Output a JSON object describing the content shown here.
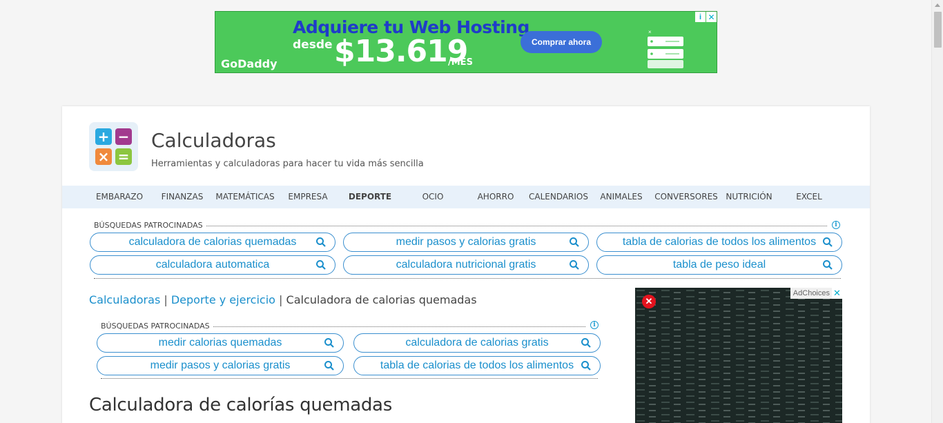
{
  "top_ad": {
    "headline": "Adquiere tu Web Hosting",
    "desde": "desde",
    "price": "$13.619",
    "per": "/MES",
    "brand": "GoDaddy",
    "cta": "Comprar ahora",
    "info_icon": "info-icon",
    "close_icon": "close-icon"
  },
  "site": {
    "title": "Calculadoras",
    "subtitle": "Herramientas y calculadoras para hacer tu vida más sencilla"
  },
  "nav": [
    {
      "label": "EMBARAZO"
    },
    {
      "label": "FINANZAS"
    },
    {
      "label": "MATEMÁTICAS"
    },
    {
      "label": "EMPRESA"
    },
    {
      "label": "DEPORTE"
    },
    {
      "label": "OCIO"
    },
    {
      "label": "AHORRO"
    },
    {
      "label": "CALENDARIOS"
    },
    {
      "label": "ANIMALES"
    },
    {
      "label": "CONVERSORES"
    },
    {
      "label": "NUTRICIÓN"
    },
    {
      "label": "EXCEL"
    }
  ],
  "sponsored_top": {
    "label": "BÚSQUEDAS PATROCINADAS",
    "items": [
      "calculadora de calorias quemadas",
      "medir pasos y calorias gratis",
      "tabla de calorias de todos los alimentos",
      "calculadora automatica",
      "calculadora nutricional gratis",
      "tabla de peso ideal"
    ]
  },
  "breadcrumb": {
    "home": "Calculadoras",
    "section": "Deporte y ejercicio",
    "current": "Calculadora de calorias quemadas",
    "sep": "|"
  },
  "sponsored_inner": {
    "label": "BÚSQUEDAS PATROCINADAS",
    "items": [
      "medir calorias quemadas",
      "calculadora de calorias gratis",
      "medir pasos y calorias gratis",
      "tabla de calorias de todos los alimentos"
    ]
  },
  "page_heading": "Calculadora de calorías quemadas",
  "side_ad": {
    "adchoices": "AdChoices"
  },
  "colors": {
    "accent": "#1a8fcc",
    "nav_bg": "#e8f1fa",
    "ad_green": "#4cc95a"
  }
}
